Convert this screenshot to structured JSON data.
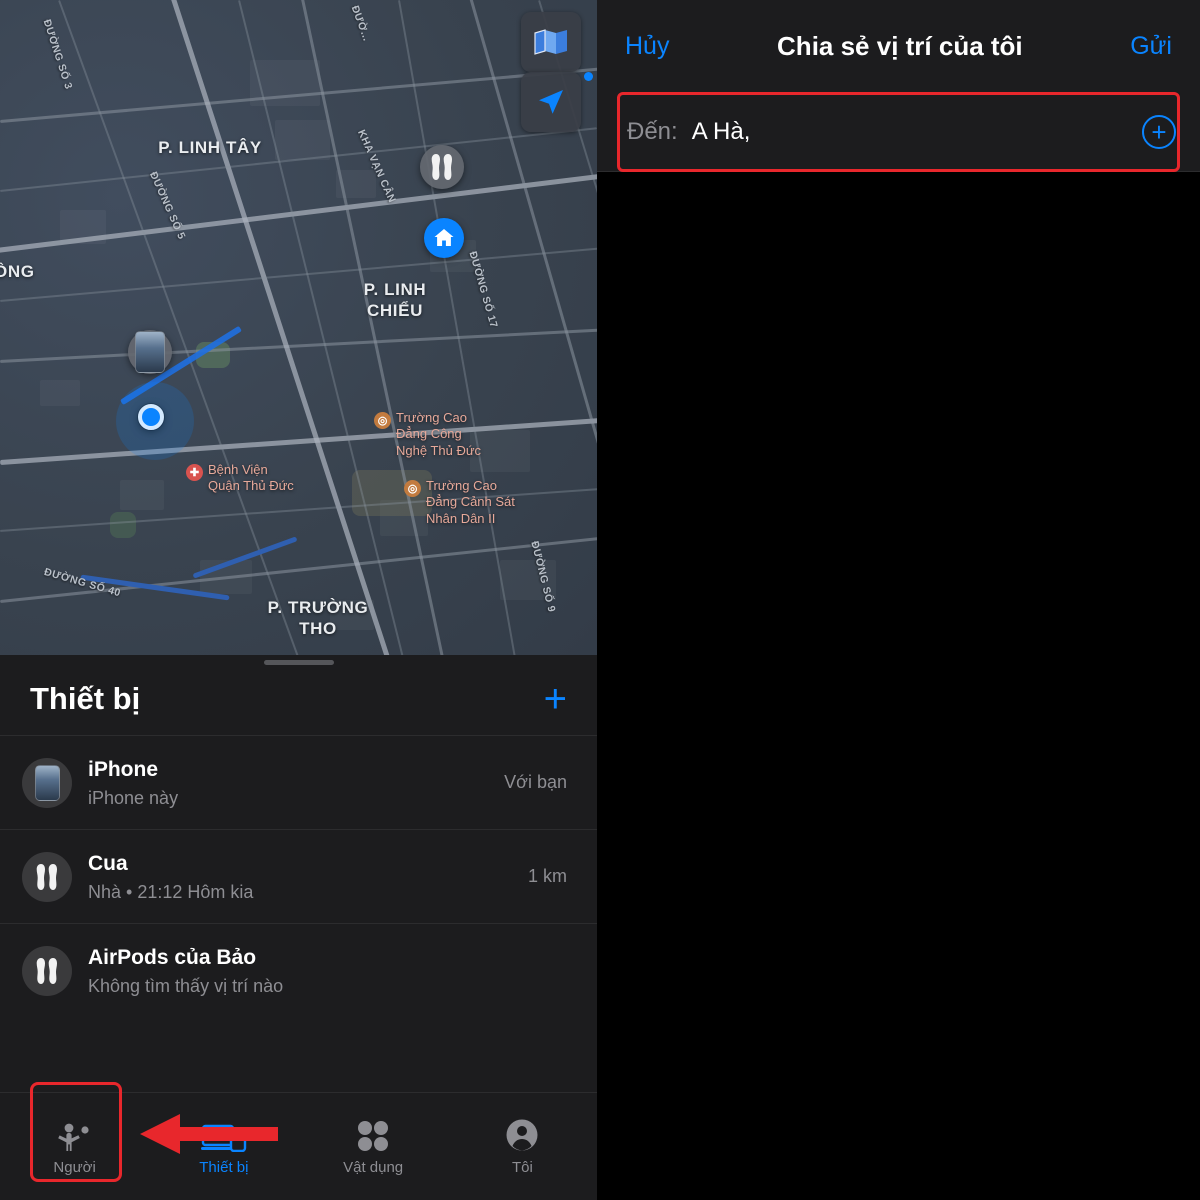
{
  "left": {
    "map": {
      "area_labels": [
        {
          "text": "P. LINH TÂY"
        },
        {
          "text": "P. LINH\nCHIỂU"
        },
        {
          "text": "P. TRƯỜNG\nTHO"
        },
        {
          "text": "ỒNG"
        }
      ],
      "street_labels": [
        {
          "text": "ĐƯỜNG SỐ 3"
        },
        {
          "text": "ĐƯỜ..."
        },
        {
          "text": "KHA VẠN CÂN"
        },
        {
          "text": "ĐƯỜNG SỐ 5"
        },
        {
          "text": "ĐƯỜNG SỐ 17"
        },
        {
          "text": "ĐƯỜNG SỐ 9"
        },
        {
          "text": "ĐƯỜNG SỐ 40"
        }
      ],
      "pois": [
        {
          "text": "Trường Cao\nĐẳng Công\nNghệ Thủ Đức",
          "kind": "edu"
        },
        {
          "text": "Bệnh Viện\nQuận Thủ Đức",
          "kind": "hospital"
        },
        {
          "text": "Trường Cao\nĐẳng Cảnh Sát\nNhân Dân II",
          "kind": "edu"
        }
      ],
      "controls": {
        "map_style": "map-icon",
        "locate": "locate-arrow-icon"
      }
    },
    "sheet": {
      "title": "Thiết bị",
      "add_label": "+",
      "devices": [
        {
          "name": "iPhone",
          "subtitle": "iPhone này",
          "right": "Với bạn",
          "icon": "iphone-icon"
        },
        {
          "name": "Cua",
          "subtitle": "Nhà • 21:12 Hôm kia",
          "right": "1 km",
          "icon": "airpods-icon"
        },
        {
          "name": "AirPods của Bảo",
          "subtitle": "Không tìm thấy vị trí nào",
          "right": "",
          "icon": "airpods-icon"
        }
      ]
    },
    "tabs": [
      {
        "label": "Người",
        "icon": "people-icon",
        "active": false
      },
      {
        "label": "Thiết bị",
        "icon": "devices-icon",
        "active": true
      },
      {
        "label": "Vật dụng",
        "icon": "items-icon",
        "active": false
      },
      {
        "label": "Tôi",
        "icon": "person-circle-icon",
        "active": false
      }
    ]
  },
  "right": {
    "nav": {
      "cancel": "Hủy",
      "title": "Chia sẻ vị trí của tôi",
      "send": "Gửi"
    },
    "to": {
      "label": "Đến:",
      "value": "A Hà,",
      "add_icon": "add-contact-icon"
    }
  },
  "annotations": {
    "accent_red": "#e8272c",
    "accent_blue": "#0a84ff"
  }
}
